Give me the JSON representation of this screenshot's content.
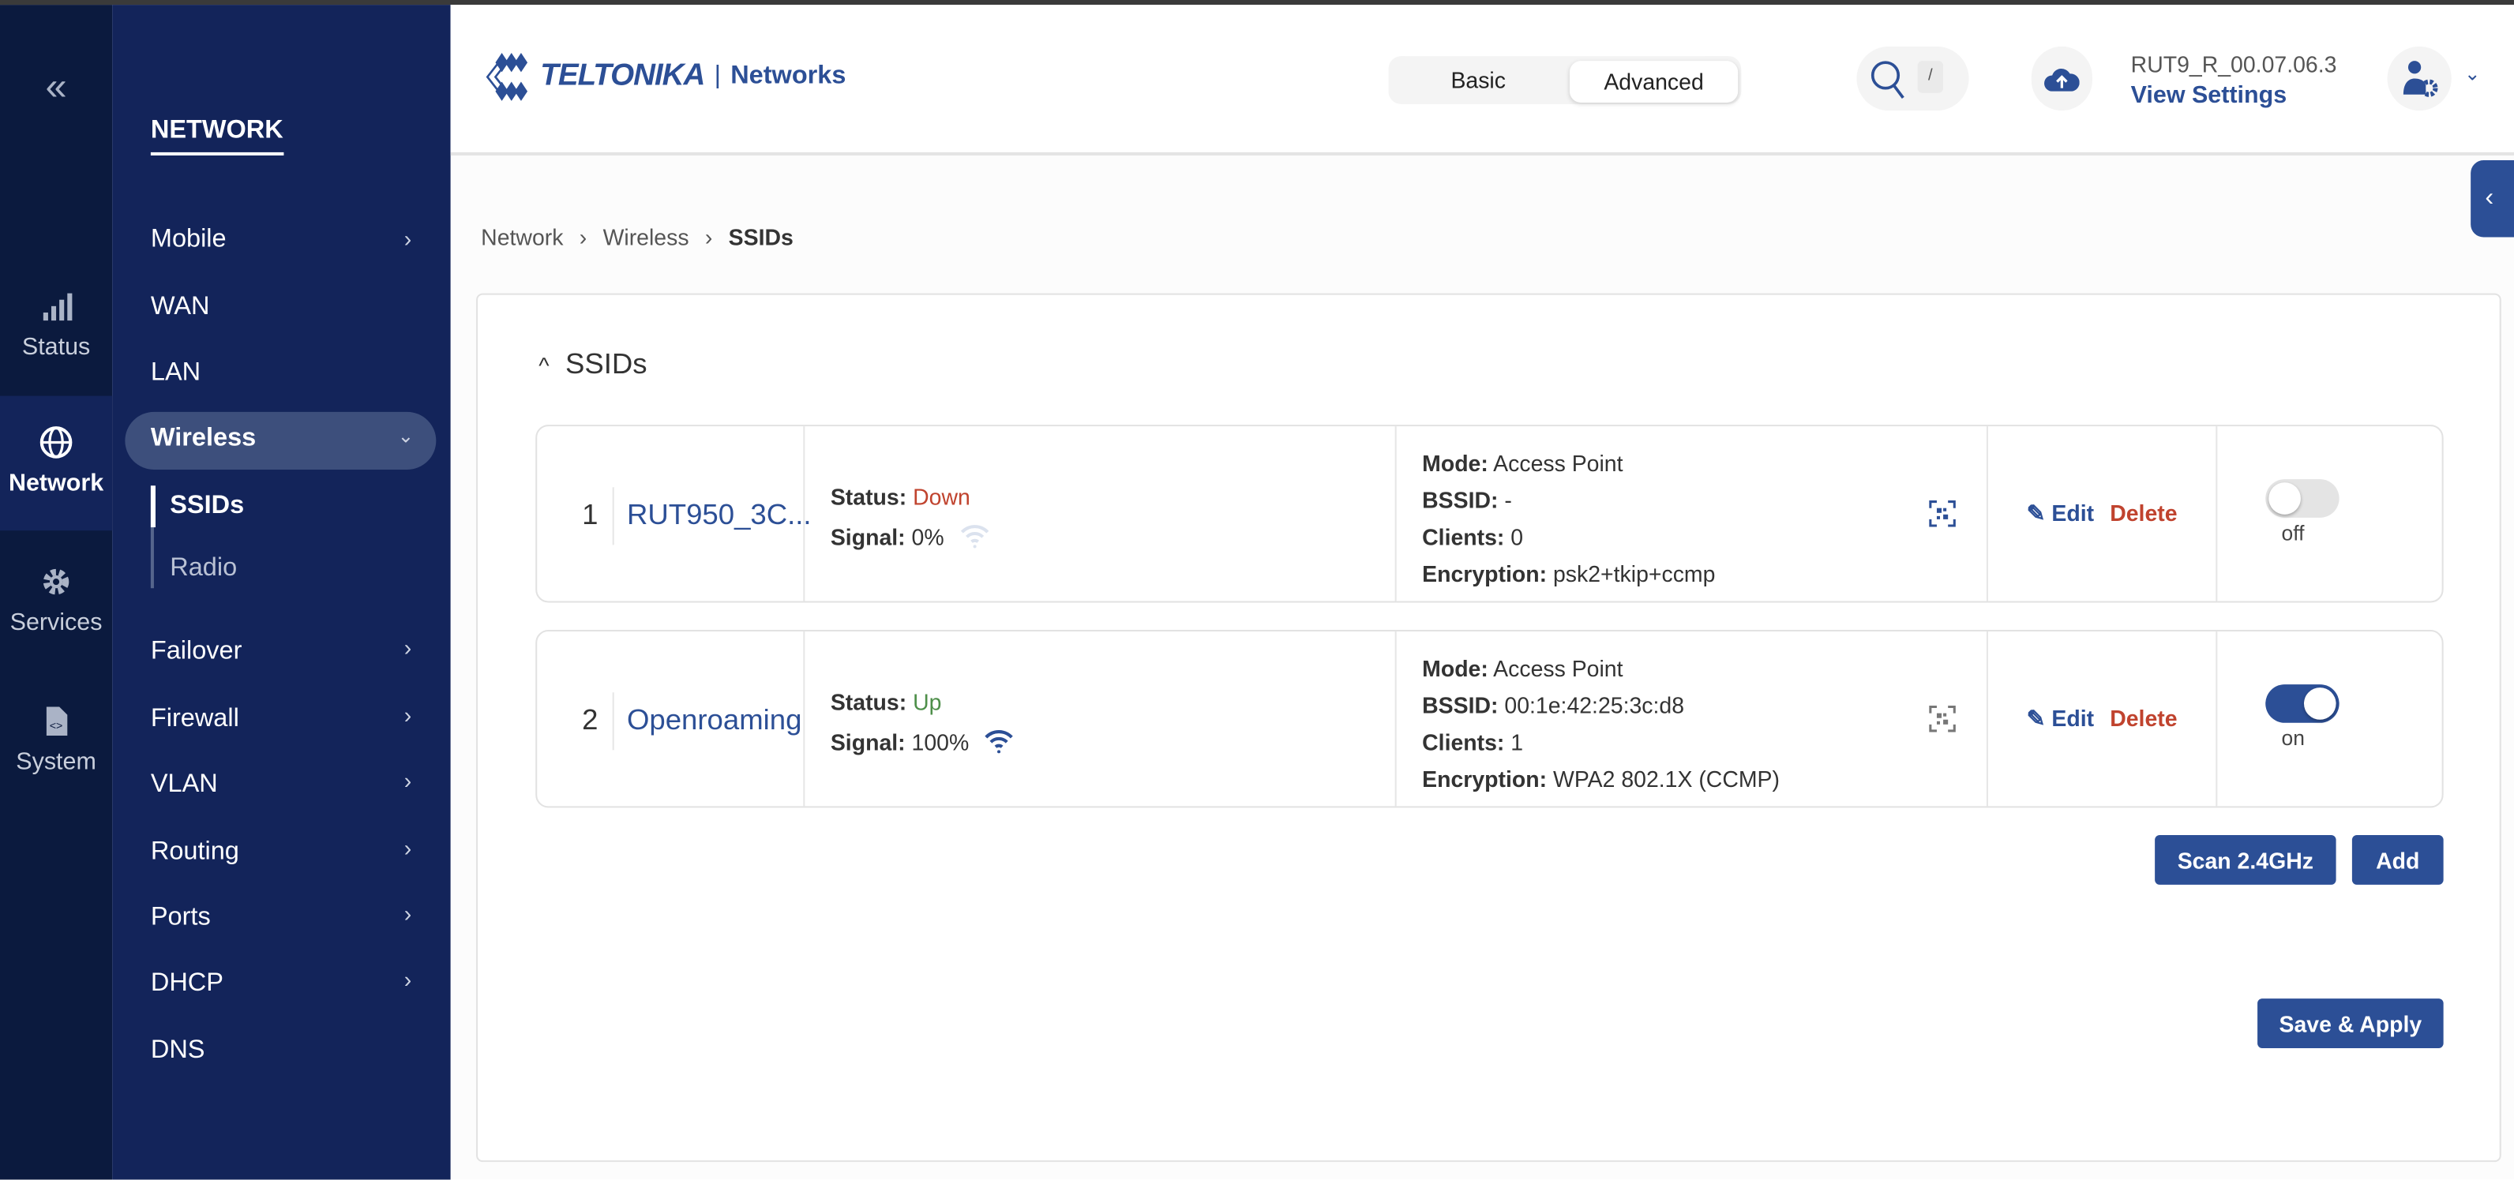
{
  "rail": {
    "items": [
      {
        "label": "Status",
        "icon": "signal-bars-icon"
      },
      {
        "label": "Network",
        "icon": "globe-icon",
        "active": true
      },
      {
        "label": "Services",
        "icon": "gear-icon"
      },
      {
        "label": "System",
        "icon": "file-code-icon"
      }
    ]
  },
  "panel": {
    "title": "NETWORK",
    "items": [
      {
        "label": "Mobile",
        "chevron": true
      },
      {
        "label": "WAN"
      },
      {
        "label": "LAN"
      },
      {
        "label": "Wireless",
        "expanded": true
      },
      {
        "label": "SSIDs",
        "sub": true,
        "active": true
      },
      {
        "label": "Radio",
        "sub": true
      },
      {
        "label": "Failover",
        "chevron": true
      },
      {
        "label": "Firewall",
        "chevron": true
      },
      {
        "label": "VLAN",
        "chevron": true
      },
      {
        "label": "Routing",
        "chevron": true
      },
      {
        "label": "Ports",
        "chevron": true
      },
      {
        "label": "DHCP",
        "chevron": true
      },
      {
        "label": "DNS"
      }
    ]
  },
  "header": {
    "logo_text": "TELTONIKA",
    "logo_sub": "Networks",
    "mode_basic": "Basic",
    "mode_advanced": "Advanced",
    "active_mode": "Advanced",
    "search_shortcut": "/",
    "firmware": "RUT9_R_00.07.06.3",
    "view_settings": "View Settings"
  },
  "breadcrumb": [
    "Network",
    "Wireless",
    "SSIDs"
  ],
  "section": {
    "title": "SSIDs"
  },
  "ssids": [
    {
      "index": "1",
      "name": "RUT950_3C...",
      "status_label": "Status:",
      "status": "Down",
      "signal_label": "Signal:",
      "signal": "0%",
      "mode_label": "Mode:",
      "mode": "Access Point",
      "bssid_label": "BSSID:",
      "bssid": "-",
      "clients_label": "Clients:",
      "clients": "0",
      "enc_label": "Encryption:",
      "encryption": "psk2+tkip+ccmp",
      "edit": "Edit",
      "delete": "Delete",
      "toggle": "off",
      "enabled": false
    },
    {
      "index": "2",
      "name": "Openroaming",
      "status_label": "Status:",
      "status": "Up",
      "signal_label": "Signal:",
      "signal": "100%",
      "mode_label": "Mode:",
      "mode": "Access Point",
      "bssid_label": "BSSID:",
      "bssid": "00:1e:42:25:3c:d8",
      "clients_label": "Clients:",
      "clients": "1",
      "enc_label": "Encryption:",
      "encryption": "WPA2 802.1X (CCMP)",
      "edit": "Edit",
      "delete": "Delete",
      "toggle": "on",
      "enabled": true
    }
  ],
  "buttons": {
    "scan": "Scan 2.4GHz",
    "add": "Add",
    "save_apply": "Save & Apply"
  },
  "colors": {
    "accent": "#2c4f96",
    "down": "#c0432e",
    "up": "#4e8f4a",
    "rail": "#0b1a3e",
    "panel": "#13245a"
  }
}
